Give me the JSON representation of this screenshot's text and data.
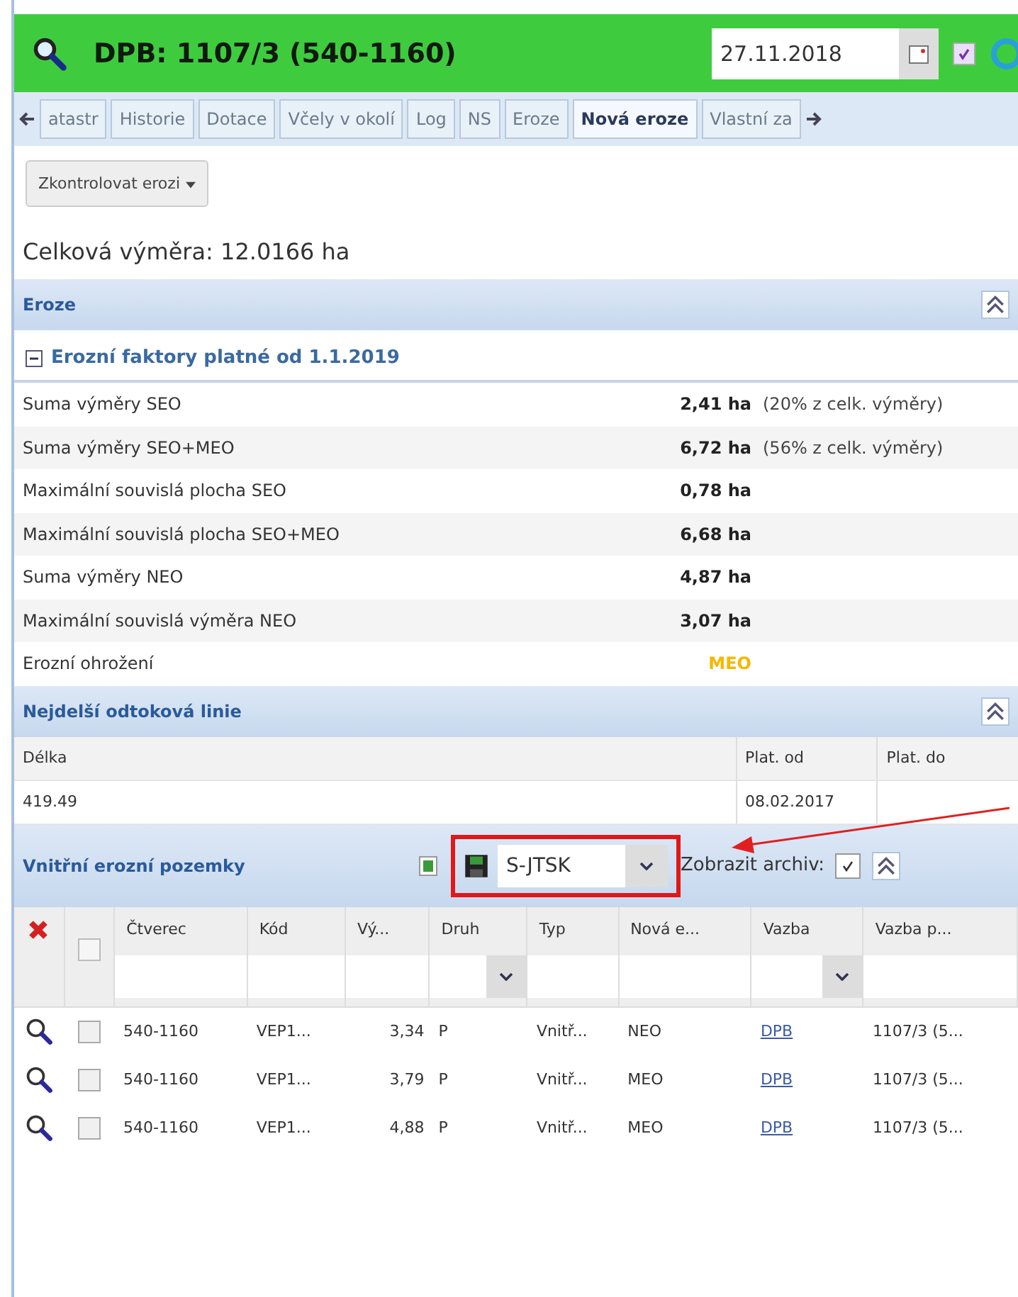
{
  "header": {
    "title": "DPB: 1107/3 (540-1160)",
    "date": "27.11.2018",
    "checked": true
  },
  "tabs": [
    {
      "label": "atastr",
      "selected": false
    },
    {
      "label": "Historie",
      "selected": false
    },
    {
      "label": "Dotace",
      "selected": false
    },
    {
      "label": "Včely v okolí",
      "selected": false
    },
    {
      "label": "Log",
      "selected": false
    },
    {
      "label": "NS",
      "selected": false
    },
    {
      "label": "Eroze",
      "selected": false
    },
    {
      "label": "Nová eroze",
      "selected": true
    },
    {
      "label": "Vlastní za",
      "selected": false
    }
  ],
  "check_button": "Zkontrolovat erozi",
  "total_area": "Celková výměra: 12.0166 ha",
  "erosion": {
    "title": "Eroze",
    "group": {
      "title": "Erozní faktory platné od 1.1.2019",
      "expanded": true
    },
    "rows": [
      {
        "label": "Suma výměry SEO",
        "value": "2,41 ha",
        "note": "(20% z celk. výměry)",
        "kind": "plain"
      },
      {
        "label": "Suma výměry SEO+MEO",
        "value": "6,72 ha",
        "note": "(56% z celk. výměry)",
        "kind": "plain"
      },
      {
        "label": "Maximální souvislá plocha SEO",
        "value": "0,78 ha",
        "kind": "plain"
      },
      {
        "label": "Maximální souvislá plocha SEO+MEO",
        "value": "6,68 ha",
        "kind": "plain"
      },
      {
        "label": "Suma výměry NEO",
        "value": "4,87 ha",
        "kind": "plain"
      },
      {
        "label": "Maximální souvislá výměra NEO",
        "value": "3,07 ha",
        "kind": "plain"
      },
      {
        "label": "Erozní ohrožení",
        "value": "MEO",
        "kind": "status",
        "color": "#f5b800"
      }
    ]
  },
  "flow_line": {
    "title": "Nejdelší odtoková linie",
    "columns": [
      "Délka",
      "Plat. od",
      "Plat. do"
    ],
    "rows": [
      [
        "419.49",
        "08.02.2017",
        ""
      ]
    ]
  },
  "parcels": {
    "title": "Vnitřní erozní pozemky",
    "crs": "S-JTSK",
    "archive_label": "Zobrazit archiv:",
    "archive_checked": true,
    "highlighted": true,
    "all_checked": false,
    "columns": [
      {
        "label": "Čtverec",
        "kind": "text"
      },
      {
        "label": "Kód",
        "kind": "text"
      },
      {
        "label": "Vý...",
        "kind": "text"
      },
      {
        "label": "Druh",
        "kind": "dropdown"
      },
      {
        "label": "Typ",
        "kind": "text"
      },
      {
        "label": "Nová e...",
        "kind": "text"
      },
      {
        "label": "Vazba",
        "kind": "dropdown"
      },
      {
        "label": "Vazba p...",
        "kind": "text"
      }
    ],
    "rows": [
      {
        "checked": false,
        "cells": [
          "540-1160",
          "VEP1...",
          "3,34",
          "P",
          "Vnitř...",
          "NEO",
          "DPB",
          "1107/3 (5..."
        ]
      },
      {
        "checked": false,
        "cells": [
          "540-1160",
          "VEP1...",
          "3,79",
          "P",
          "Vnitř...",
          "MEO",
          "DPB",
          "1107/3 (5..."
        ]
      },
      {
        "checked": false,
        "cells": [
          "540-1160",
          "VEP1...",
          "4,88",
          "P",
          "Vnitř...",
          "MEO",
          "DPB",
          "1107/3 (5..."
        ]
      }
    ]
  }
}
